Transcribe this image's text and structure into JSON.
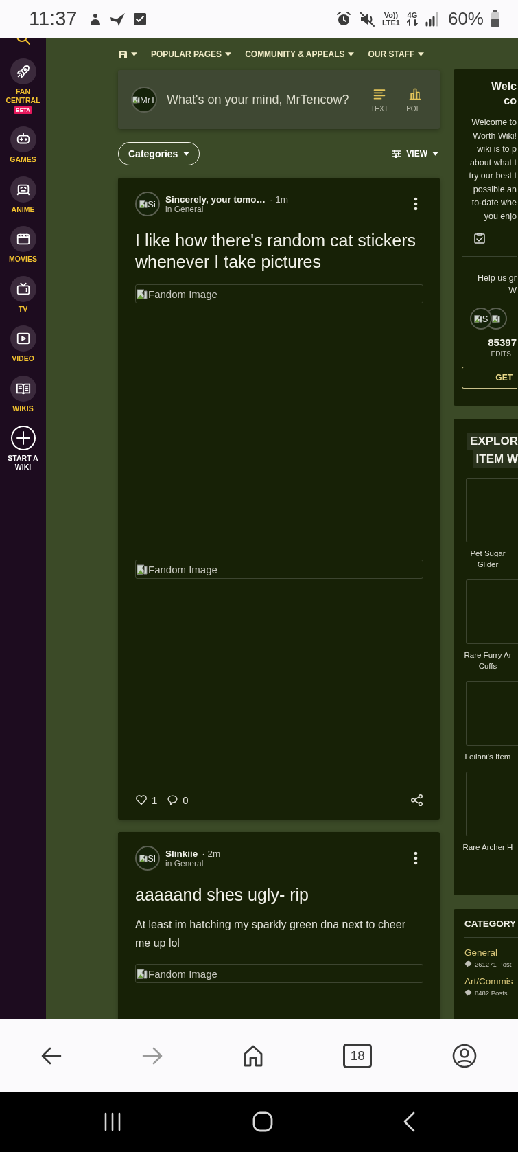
{
  "status_bar": {
    "time": "11:37",
    "volte_top": "Vo))",
    "volte_bottom": "LTE1",
    "network": "4G",
    "battery": "60%"
  },
  "sidebar": {
    "items": [
      {
        "label": "FAN CENTRAL",
        "badge": "BETA",
        "kind": "vertical"
      },
      {
        "label": "GAMES",
        "kind": "vertical"
      },
      {
        "label": "ANIME",
        "kind": "vertical"
      },
      {
        "label": "MOVIES",
        "kind": "vertical"
      },
      {
        "label": "TV",
        "kind": "vertical"
      },
      {
        "label": "VIDEO",
        "kind": "vertical"
      },
      {
        "label": "WIKIS",
        "kind": "vertical"
      },
      {
        "label": "START A WIKI",
        "kind": "create"
      }
    ]
  },
  "top_nav": {
    "items": [
      {
        "label": "POPULAR PAGES"
      },
      {
        "label": "COMMUNITY & APPEALS"
      },
      {
        "label": "OUR STAFF"
      }
    ]
  },
  "composer": {
    "avatar_alt": "MrT",
    "placeholder": "What's on your mind, MrTencow?",
    "actions": [
      {
        "label": "TEXT",
        "kind": "text"
      },
      {
        "label": "POLL",
        "kind": "poll"
      }
    ]
  },
  "filters": {
    "categories": "Categories",
    "view": "VIEW"
  },
  "posts": [
    {
      "avatar_alt": "Si",
      "author": "Sincerely, your tomo…",
      "time": "· 1m",
      "category": "in General",
      "title": "I like how there's random cat stickers whenever I take pictures",
      "images": [
        "Fandom Image",
        "Fandom Image"
      ],
      "likes": "1",
      "comments": "0"
    },
    {
      "avatar_alt": "Sl",
      "author": "Slinkiie",
      "time": "· 2m",
      "category": "in General",
      "title": "aaaaand shes ugly- rip",
      "body": "At least im hatching my sparkly green dna next to cheer me up lol",
      "images": [
        "Fandom Image"
      ]
    }
  ],
  "welcome_card": {
    "title_lines": [
      "Welc",
      "co"
    ],
    "text_lines": [
      "Welcome to",
      "Worth Wiki!",
      "wiki is to p",
      "about what t",
      "try our best t",
      "possible an",
      "to-date whe",
      "you enjo"
    ],
    "help_lines": [
      "Help us gr",
      "W"
    ],
    "avatars": [
      {
        "alt": "S"
      }
    ],
    "edits": "85397",
    "edits_label": "EDITS",
    "button": "GET"
  },
  "explore_card": {
    "title_lines": [
      "EXPLOR",
      "ITEM W"
    ],
    "items": [
      {
        "lines": [
          "Pet Sugar",
          "Glider"
        ]
      },
      {
        "lines": [
          "Rare Furry Ar",
          "Cuffs"
        ]
      },
      {
        "lines": [
          "Leilani's Item"
        ]
      },
      {
        "lines": [
          "Rare Archer H"
        ]
      }
    ]
  },
  "categories_card": {
    "title": "CATEGORY",
    "items": [
      {
        "name": "General",
        "posts": "261271 Post"
      },
      {
        "name": "Art/Commis",
        "posts": "8482 Posts"
      }
    ]
  },
  "browser_bar": {
    "tab_count": "18"
  }
}
